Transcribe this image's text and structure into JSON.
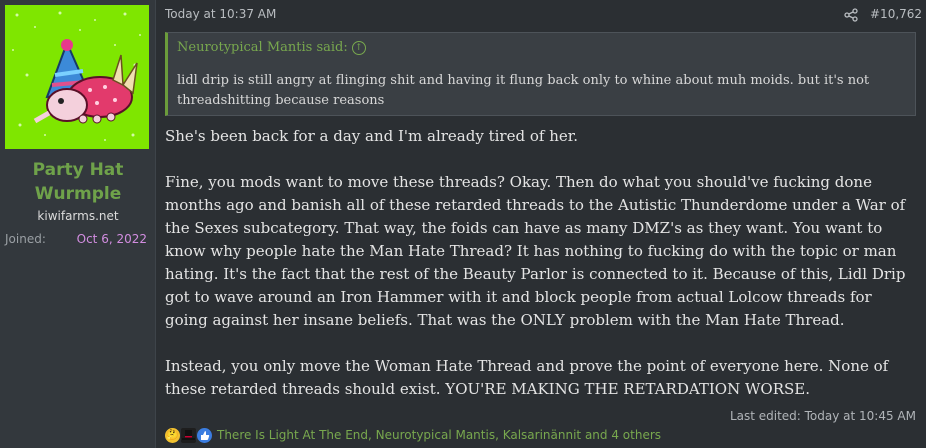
{
  "user": {
    "name": "Party Hat Wurmple",
    "title": "kiwifarms.net",
    "joined_label": "Joined:",
    "joined_value": "Oct 6, 2022"
  },
  "post": {
    "date": "Today at 10:37 AM",
    "number": "#10,762",
    "quote": {
      "author_line": "Neurotypical Mantis said:",
      "body": "lidl drip is still angry at flinging shit and having it flung back only to whine about muh moids. but it's not threadshitting because reasons"
    },
    "paragraphs": [
      "She's been back for a day and I'm already tired of her.",
      "Fine, you mods want to move these threads? Okay. Then do what you should've fucking done months ago and banish all of these retarded threads to the Autistic Thunderdome under a War of the Sexes subcategory. That way, the foids can have as many DMZ's as they want. You want to know why people hate the Man Hate Thread? It has nothing to fucking do with the topic or man hating. It's the fact that the rest of the Beauty Parlor is connected to it. Because of this, Lidl Drip got to wave around an Iron Hammer with it and block people from actual Lolcow threads for going against her insane beliefs. That was the ONLY problem with the Man Hate Thread.",
      "Instead, you only move the Woman Hate Thread and prove the point of everyone here. None of these retarded threads should exist. YOU'RE MAKING THE RETARDATION WORSE."
    ],
    "last_edited": "Last edited: Today at 10:45 AM",
    "reactions_text": "There Is Light At The End, Neurotypical Mantis, Kalsarinännit and 4 others",
    "reaction_icons": [
      "thinking-emoji-icon",
      "top-hat-icon",
      "thumbs-up-icon"
    ]
  },
  "colors": {
    "avatar_bg": "#7fe600",
    "username": "#6fa24a",
    "joined_value": "#d28de0",
    "quote_accent": "#78a84e"
  }
}
